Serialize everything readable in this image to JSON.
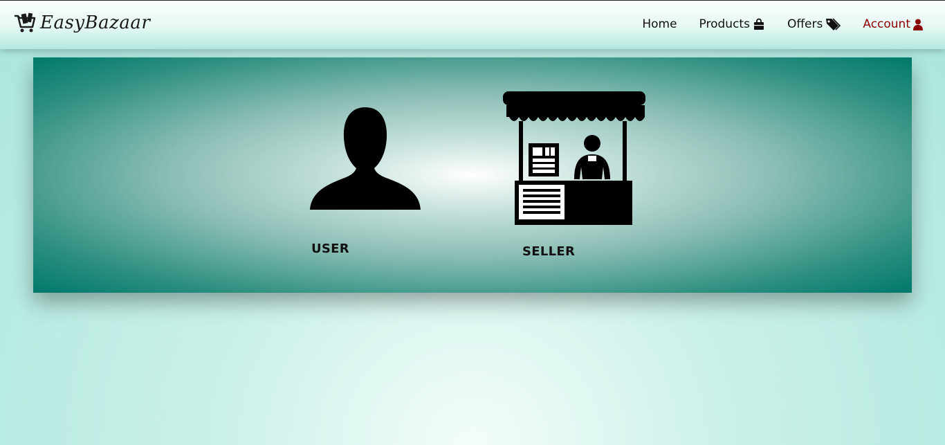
{
  "brand": {
    "name": "EasyBazaar"
  },
  "nav": {
    "home": "Home",
    "products": "Products",
    "offers": "Offers",
    "account": "Account"
  },
  "icons": {
    "logo": "shopping-cart-icon",
    "products": "shopping-bag-icon",
    "offers": "tag-icon",
    "account": "user-icon",
    "user_role": "user-silhouette-icon",
    "seller_role": "market-stall-icon"
  },
  "colors": {
    "account_active": "#8b0000",
    "panel_edge": "#00796b"
  },
  "roles": {
    "user": "USER",
    "seller": "SELLER"
  }
}
